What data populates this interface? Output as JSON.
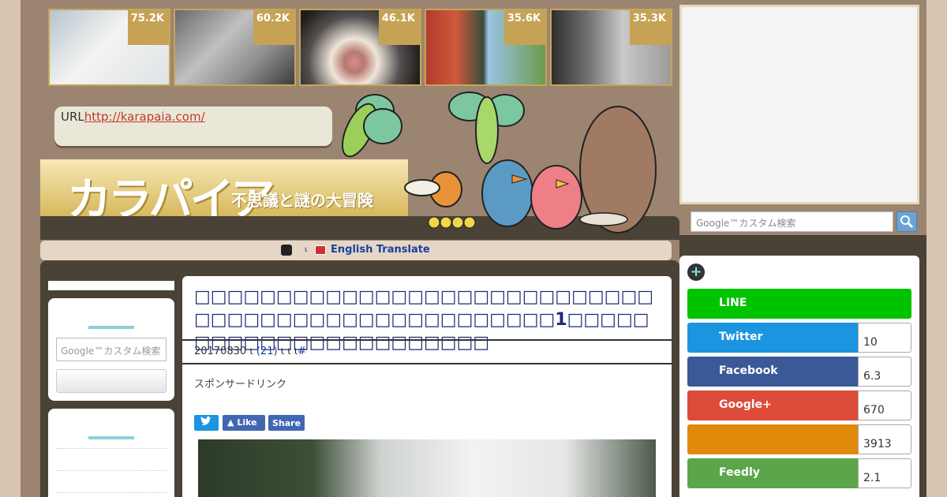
{
  "thumbnails": [
    {
      "count": "75.2K",
      "icon": "mouse-photo-icon"
    },
    {
      "count": "60.2K",
      "icon": "man-cats-photo-icon"
    },
    {
      "count": "46.1K",
      "icon": "cat-tongue-photo-icon"
    },
    {
      "count": "35.6K",
      "icon": "geisha-eiffel-photo-icon"
    },
    {
      "count": "35.3K",
      "icon": "empty-shelves-photo-icon"
    }
  ],
  "header": {
    "url_label": "URL",
    "url_link": "http://karapaia.com/",
    "logo_title": "カラパイア",
    "logo_subtitle": "不思議と謎の大冒険"
  },
  "search": {
    "placeholder": "Google™カスタム検索"
  },
  "translate": {
    "small": "ι",
    "label": "English Translate"
  },
  "article": {
    "title": "1",
    "date": "20170830",
    "sep1": "ι",
    "comments": "(21)",
    "sep2": "ι  ι",
    "sep3": "ι",
    "hash": "#",
    "sponsor": "スポンサードリンク",
    "share_buttons": {
      "like": "Like",
      "share": "Share"
    }
  },
  "social": [
    {
      "name": "LINE",
      "count": "",
      "color": "#00b900"
    },
    {
      "name": "Twitter",
      "count": "10",
      "color": "#1b95e0"
    },
    {
      "name": "Facebook",
      "count": "6.3",
      "color": "#3b5998"
    },
    {
      "name": "Google+",
      "count": "670",
      "color": "#dd4b39"
    },
    {
      "name": "",
      "count": "3913",
      "color": "#e08a0b"
    },
    {
      "name": "Feedly",
      "count": "2.1",
      "color": "#5ba64a"
    }
  ]
}
